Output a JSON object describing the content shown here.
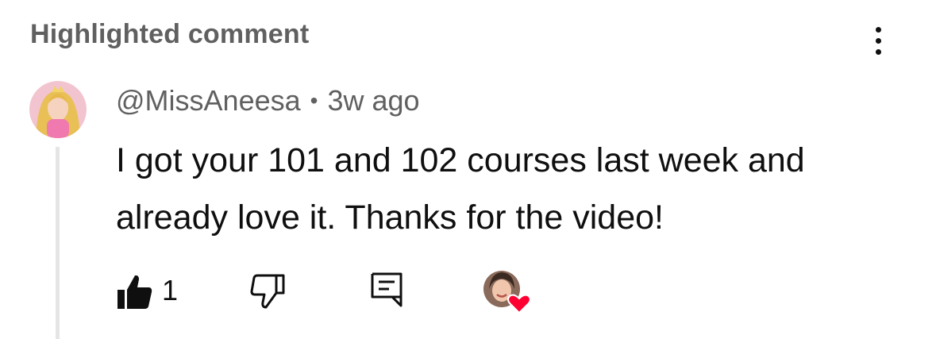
{
  "header": {
    "title": "Highlighted comment",
    "menu_icon": "more-vertical-icon"
  },
  "comment": {
    "author": "@MissAneesa",
    "separator": "•",
    "timestamp": "3w ago",
    "text": "I got your 101 and 102 courses last week and already love it. Thanks for the video!",
    "avatar_icon": "user-avatar"
  },
  "actions": {
    "like_count": "1",
    "like_icon": "thumbs-up-icon",
    "dislike_icon": "thumbs-down-icon",
    "reply_icon": "reply-comment-icon",
    "creator_heart_icon": "creator-heart-badge"
  },
  "colors": {
    "primary_text": "#0f0f0f",
    "secondary_text": "#606060",
    "heart": "#ff0033",
    "thread_line": "#e5e5e5"
  }
}
